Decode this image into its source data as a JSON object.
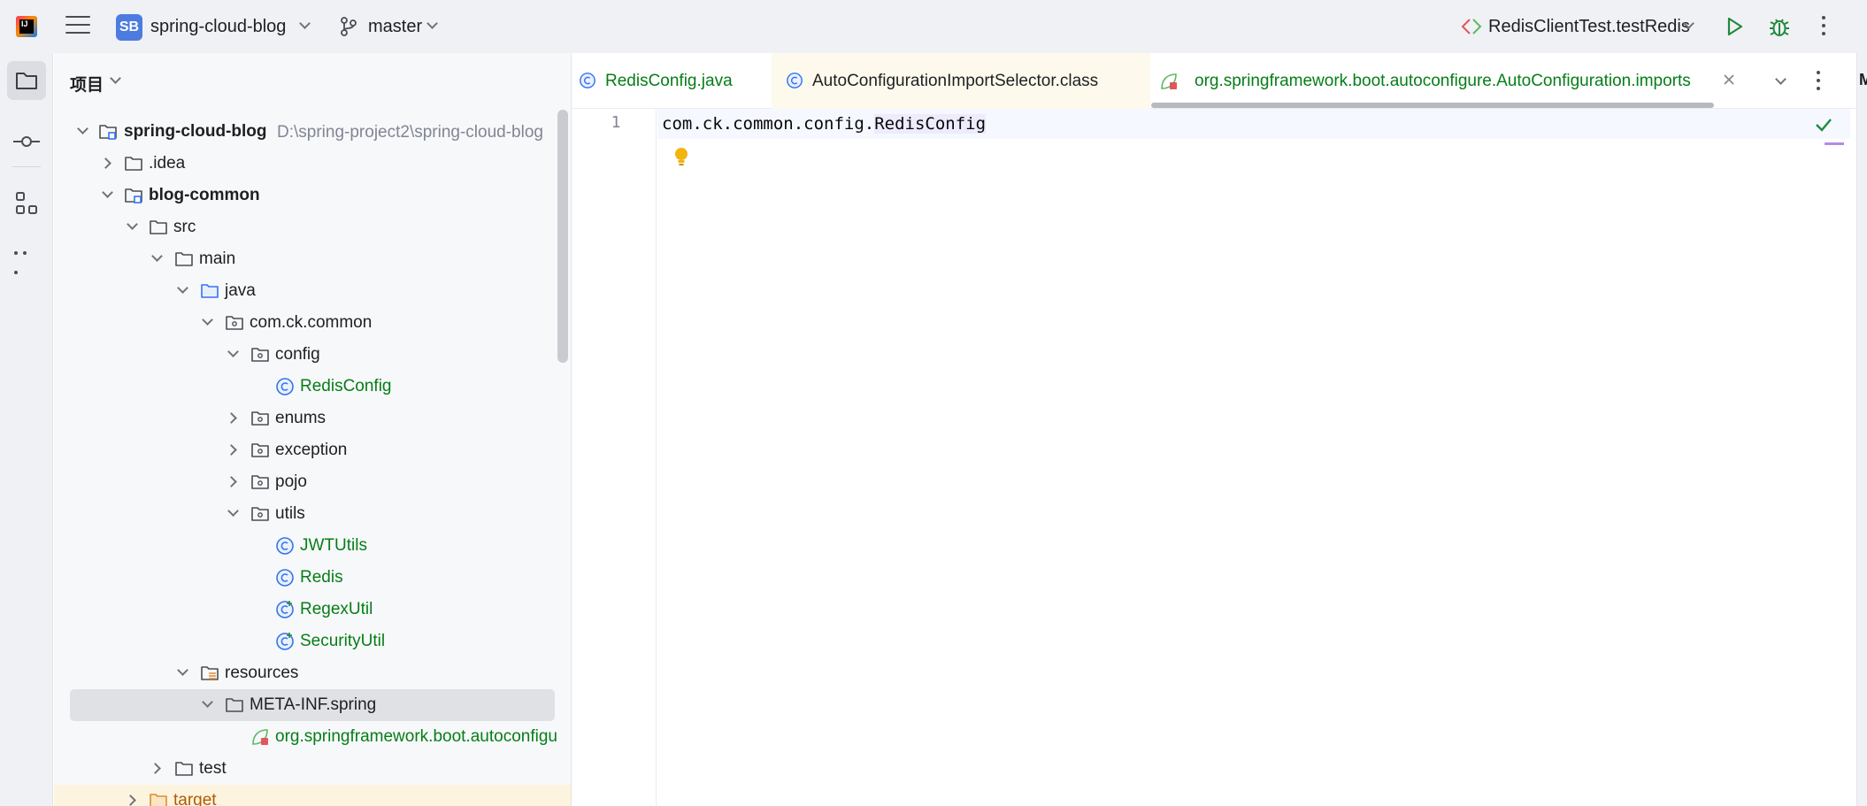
{
  "titlebar": {
    "project_badge": "SB",
    "project_name": "spring-cloud-blog",
    "branch": "master",
    "run_config": "RedisClientTest.testRedis"
  },
  "project_panel": {
    "title": "项目",
    "tree": [
      {
        "label": "spring-cloud-blog",
        "path": "D:\\spring-project2\\spring-cloud-blog"
      },
      {
        "label": ".idea"
      },
      {
        "label": "blog-common"
      },
      {
        "label": "src"
      },
      {
        "label": "main"
      },
      {
        "label": "java"
      },
      {
        "label": "com.ck.common"
      },
      {
        "label": "config"
      },
      {
        "label": "RedisConfig"
      },
      {
        "label": "enums"
      },
      {
        "label": "exception"
      },
      {
        "label": "pojo"
      },
      {
        "label": "utils"
      },
      {
        "label": "JWTUtils"
      },
      {
        "label": "Redis"
      },
      {
        "label": "RegexUtil"
      },
      {
        "label": "SecurityUtil"
      },
      {
        "label": "resources"
      },
      {
        "label": "META-INF.spring"
      },
      {
        "label": "org.springframework.boot.autoconfigu"
      },
      {
        "label": "test"
      },
      {
        "label": "target"
      }
    ]
  },
  "editor": {
    "tabs": [
      {
        "label": "RedisConfig.java"
      },
      {
        "label": "AutoConfigurationImportSelector.class"
      },
      {
        "label": "org.springframework.boot.autoconfigure.AutoConfiguration.imports"
      }
    ],
    "line_number": "1",
    "code_prefix": "com.ck.common.config.",
    "code_highlight": "RedisConfig",
    "right_panel_letter": "M"
  },
  "colors": {
    "accent": "#3574f0",
    "class_green": "#067d17",
    "check_green": "#208a3c"
  }
}
